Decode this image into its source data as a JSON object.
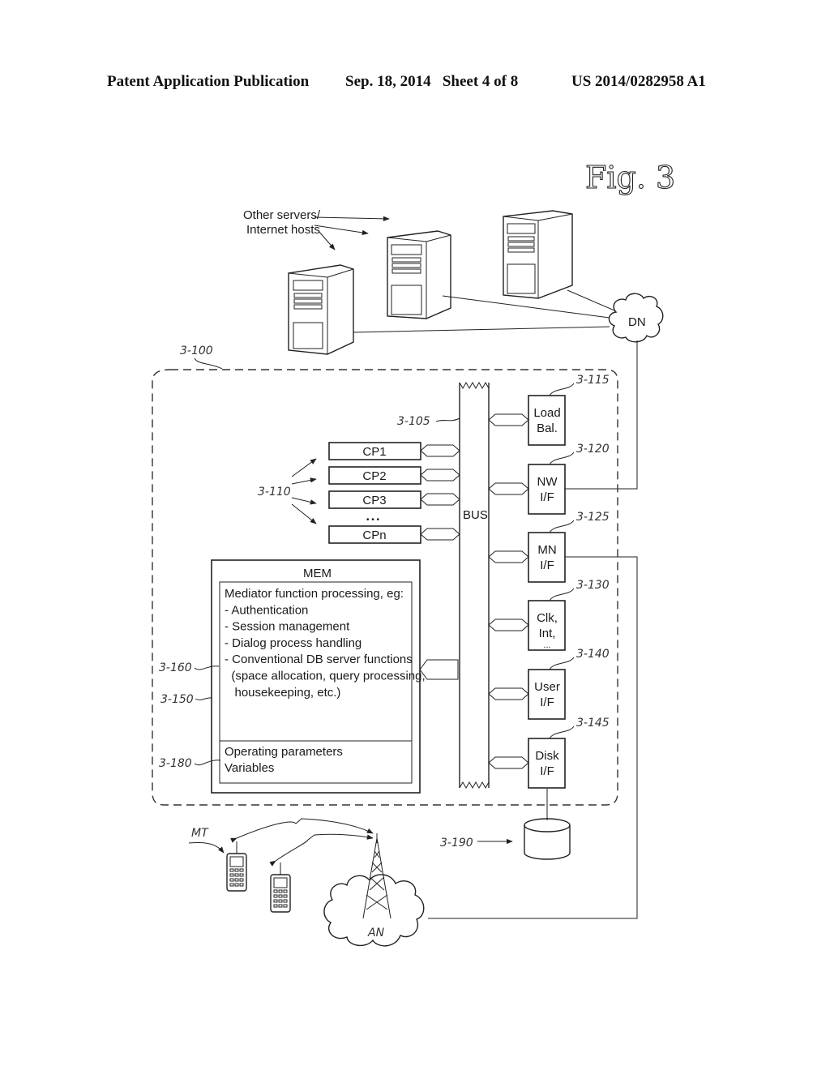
{
  "header": {
    "publication_type": "Patent Application Publication",
    "date_sheet": "Sep. 18, 2014   Sheet 4 of 8",
    "patent_number": "US 2014/0282958 A1"
  },
  "figure": {
    "title": "Fig. 3",
    "servers_label_line1": "Other servers/",
    "servers_label_line2": "Internet hosts",
    "data_network": "DN",
    "access_network": "AN",
    "mobile_terminal": "MT",
    "system_ref": "3-100",
    "bus": {
      "label": "BUS",
      "ref": "3-105"
    },
    "processors": {
      "ref": "3-110",
      "items": [
        "CP1",
        "CP2",
        "CP3",
        "CPn"
      ],
      "ellipsis": "• • •"
    },
    "peripherals": [
      {
        "ref": "3-115",
        "line1": "Load",
        "line2": "Bal.",
        "line3": ""
      },
      {
        "ref": "3-120",
        "line1": "NW",
        "line2": "I/F",
        "line3": ""
      },
      {
        "ref": "3-125",
        "line1": "MN",
        "line2": "I/F",
        "line3": ""
      },
      {
        "ref": "3-130",
        "line1": "Clk,",
        "line2": "Int,",
        "line3": "..."
      },
      {
        "ref": "3-140",
        "line1": "User",
        "line2": "I/F",
        "line3": ""
      },
      {
        "ref": "3-145",
        "line1": "Disk",
        "line2": "I/F",
        "line3": ""
      }
    ],
    "memory": {
      "title": "MEM",
      "ref_outer": "3-150",
      "ref_program": "3-160",
      "ref_params": "3-180",
      "program_lines": [
        "Mediator function processing, eg:",
        "- Authentication",
        "- Session management",
        "- Dialog process handling",
        "- Conventional DB server functions",
        "  (space allocation, query processing,",
        "   housekeeping, etc.)"
      ],
      "param_lines": [
        "Operating parameters",
        "Variables"
      ]
    },
    "storage_ref": "3-190"
  }
}
